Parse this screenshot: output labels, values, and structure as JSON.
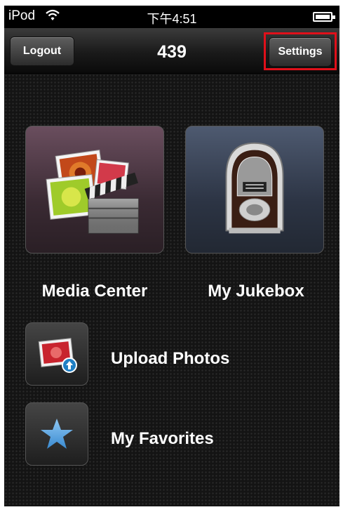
{
  "status_bar": {
    "carrier": "iPod",
    "time": "下午4:51"
  },
  "nav": {
    "logout_label": "Logout",
    "title": "439",
    "settings_label": "Settings"
  },
  "tiles": [
    {
      "label": "Media Center",
      "icon": "media-center-icon"
    },
    {
      "label": "My Jukebox",
      "icon": "jukebox-icon"
    }
  ],
  "rows": [
    {
      "label": "Upload Photos",
      "icon": "upload-photos-icon"
    },
    {
      "label": "My Favorites",
      "icon": "star-icon"
    }
  ],
  "colors": {
    "highlight": "#e0101a",
    "background": "#141414"
  }
}
